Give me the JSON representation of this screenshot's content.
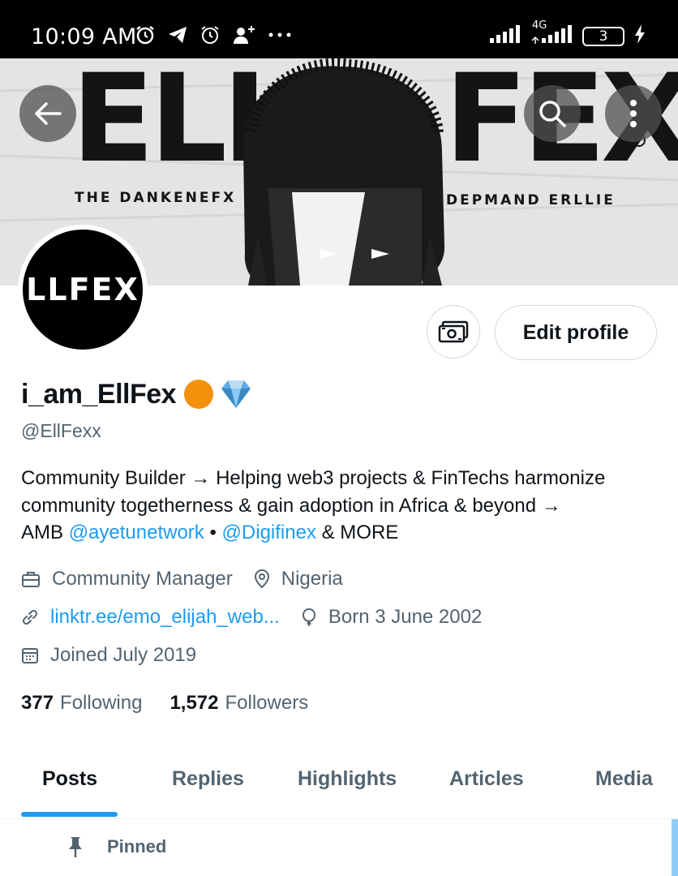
{
  "status_bar": {
    "time": "10:09 AM",
    "network": "4G",
    "battery": "3",
    "icons": [
      "alarm-icon",
      "telegram-icon",
      "alarm-icon",
      "person-add-icon",
      "more-dots-icon",
      "signal-icon",
      "charging-icon"
    ]
  },
  "banner": {
    "big_text_left": "ELL",
    "big_text_right": "FEX",
    "caption_left": "THE DANKENEFX",
    "caption_right": "DEPMAND ERLLIE"
  },
  "avatar": {
    "text": "ELLFEX"
  },
  "actions": {
    "edit_profile_label": "Edit profile"
  },
  "profile": {
    "name": "i_am_EllFex",
    "name_emojis": "🟠💎",
    "handle": "@EllFexx",
    "bio": {
      "line1": "Community Builder → Helping web3 projects & FinTechs harmonize",
      "line2": "community togetherness & gain adoption in Africa & beyond →",
      "line3_prefix": "AMB ",
      "mention1": "@ayetunetwork",
      "separator": " • ",
      "mention2": "@Digifinex",
      "line3_suffix": " & MORE"
    },
    "occupation": "Community Manager",
    "location": "Nigeria",
    "link": "linktr.ee/emo_elijah_web...",
    "born": "Born 3 June 2002",
    "joined": "Joined July 2019",
    "following_count": "377",
    "following_label": "Following",
    "followers_count": "1,572",
    "followers_label": "Followers"
  },
  "tabs": [
    "Posts",
    "Replies",
    "Highlights",
    "Articles",
    "Media"
  ],
  "active_tab": "Posts",
  "pinned_label": "Pinned",
  "colors": {
    "accent": "#1d9bf0",
    "secondary_text": "#536471",
    "primary_text": "#0f1419"
  }
}
